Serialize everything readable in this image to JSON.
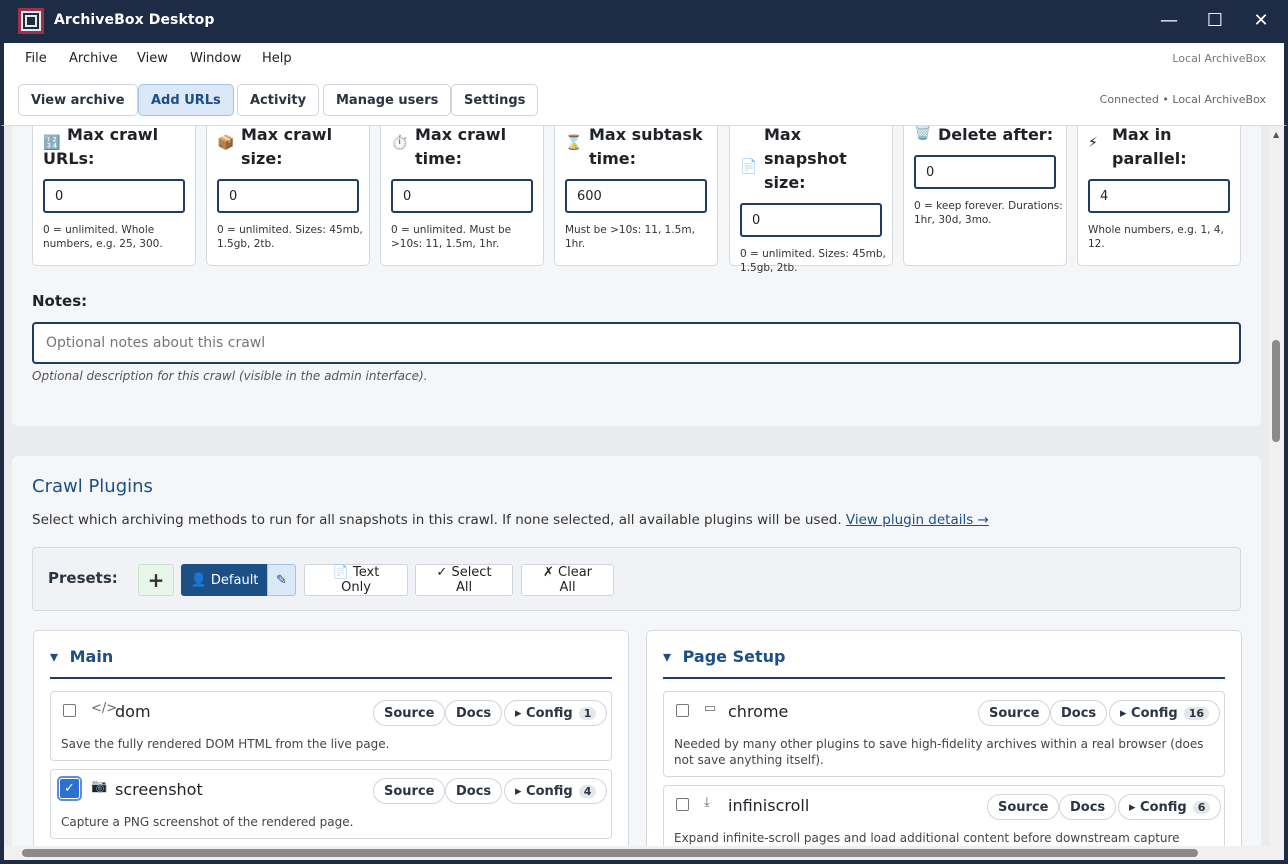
{
  "window": {
    "title": "ArchiveBox Desktop"
  },
  "menu": {
    "items": [
      "File",
      "Archive",
      "View",
      "Window",
      "Help"
    ],
    "right_label": "Local ArchiveBox"
  },
  "toolbar": {
    "buttons": [
      "View archive",
      "Add URLs",
      "Activity",
      "Manage users",
      "Settings"
    ],
    "active": "Add URLs",
    "status": "Connected • Local ArchiveBox"
  },
  "limits": [
    {
      "icon": "🔢",
      "label_lines": [
        "Max crawl",
        "URLs:"
      ],
      "value": "0",
      "hint": "0 = unlimited. Whole numbers, e.g. 25, 300."
    },
    {
      "icon": "📦",
      "label_lines": [
        "Max crawl",
        "size:"
      ],
      "value": "0",
      "hint": "0 = unlimited. Sizes: 45mb, 1.5gb, 2tb."
    },
    {
      "icon": "⏱️",
      "label_lines": [
        "Max crawl",
        "time:"
      ],
      "value": "0",
      "hint": "0 = unlimited. Must be >10s: 11, 1.5m, 1hr."
    },
    {
      "icon": "⌛",
      "label_lines": [
        "Max subtask",
        "time:"
      ],
      "value": "600",
      "hint": "Must be >10s: 11, 1.5m, 1hr."
    },
    {
      "icon": "📄",
      "label_lines": [
        "Max",
        "snapshot",
        "size:"
      ],
      "value": "0",
      "hint": "0 = unlimited. Sizes: 45mb, 1.5gb, 2tb."
    },
    {
      "icon": "🗑️",
      "label_lines": [
        "Delete after:"
      ],
      "value": "0",
      "hint": "0 = keep forever. Durations: 1hr, 30d, 3mo."
    },
    {
      "icon": "⚡",
      "label_lines": [
        "Max in",
        "parallel:"
      ],
      "value": "4",
      "hint": "Whole numbers, e.g. 1, 4, 12."
    }
  ],
  "notes": {
    "label": "Notes:",
    "placeholder": "Optional notes about this crawl",
    "help": "Optional description for this crawl (visible in the admin interface)."
  },
  "plugins_section": {
    "title": "Crawl Plugins",
    "description": "Select which archiving methods to run for all snapshots in this crawl. If none selected, all available plugins will be used.",
    "link": "View plugin details →"
  },
  "presets": {
    "label": "Presets:",
    "add": "+",
    "default": "👤 Default",
    "edit": "✎",
    "text_only": "📄 Text Only",
    "select_all": "✓ Select All",
    "clear_all": "✗ Clear All"
  },
  "groups": [
    {
      "title": "Main",
      "plugins": [
        {
          "name": "dom",
          "icon": "</>",
          "checked": false,
          "config_count": "1",
          "desc": "Save the fully rendered DOM HTML from the live page."
        },
        {
          "name": "screenshot",
          "icon": "📷",
          "checked": true,
          "config_count": "4",
          "desc": "Capture a PNG screenshot of the rendered page."
        }
      ]
    },
    {
      "title": "Page Setup",
      "plugins": [
        {
          "name": "chrome",
          "icon": "▭",
          "checked": false,
          "config_count": "16",
          "desc": "Needed by many other plugins to save high-fidelity archives within a real browser (does not save anything itself)."
        },
        {
          "name": "infiniscroll",
          "icon": "⤓",
          "checked": false,
          "config_count": "6",
          "desc": "Expand infinite-scroll pages and load additional content before downstream capture"
        }
      ]
    }
  ],
  "chip_labels": {
    "source": "Source",
    "docs": "Docs",
    "config": "▸ Config"
  },
  "colors": {
    "titlebar": "#1e2b45",
    "accent": "#1c4f86",
    "logo_border": "#a0304a",
    "active_btn": "#dbe8f7"
  }
}
